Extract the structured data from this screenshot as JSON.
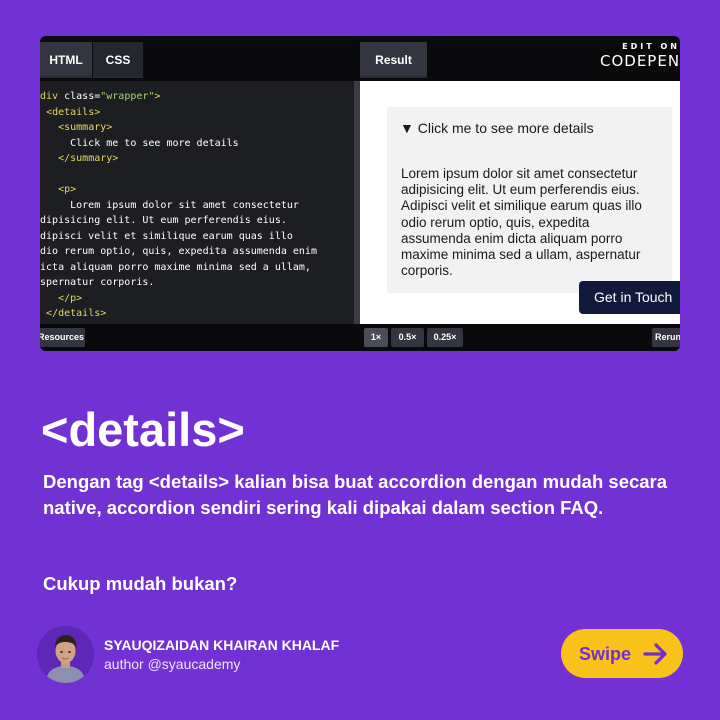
{
  "editor": {
    "tabs": {
      "html": "HTML",
      "css": "CSS",
      "result": "Result"
    },
    "logo": {
      "top": "EDIT ON",
      "name": "CODEPEN"
    },
    "code_lines": [
      [
        {
          "t": "tag",
          "v": "<div "
        },
        {
          "t": "attr",
          "v": "class="
        },
        {
          "t": "str",
          "v": "\"wrapper\""
        },
        {
          "t": "tag",
          "v": ">"
        }
      ],
      [
        {
          "t": "plain",
          "v": "  "
        },
        {
          "t": "tag",
          "v": "<details>"
        }
      ],
      [
        {
          "t": "plain",
          "v": "    "
        },
        {
          "t": "tag",
          "v": "<summary>"
        }
      ],
      [
        {
          "t": "plain",
          "v": "      Click me to see more details"
        }
      ],
      [
        {
          "t": "plain",
          "v": "    "
        },
        {
          "t": "tag",
          "v": "</summary>"
        }
      ],
      [
        {
          "t": "plain",
          "v": ""
        }
      ],
      [
        {
          "t": "plain",
          "v": "    "
        },
        {
          "t": "tag",
          "v": "<p>"
        }
      ],
      [
        {
          "t": "plain",
          "v": "      Lorem ipsum dolor sit amet consectetur"
        }
      ],
      [
        {
          "t": "plain",
          "v": "adipisicing elit. Ut eum perferendis eius."
        }
      ],
      [
        {
          "t": "plain",
          "v": "Adipisci velit et similique earum quas illo"
        }
      ],
      [
        {
          "t": "plain",
          "v": "odio rerum optio, quis, expedita assumenda enim"
        }
      ],
      [
        {
          "t": "plain",
          "v": "dicta aliquam porro maxime minima sed a ullam,"
        }
      ],
      [
        {
          "t": "plain",
          "v": "aspernatur corporis."
        }
      ],
      [
        {
          "t": "plain",
          "v": "    "
        },
        {
          "t": "tag",
          "v": "</p>"
        }
      ],
      [
        {
          "t": "plain",
          "v": "  "
        },
        {
          "t": "tag",
          "v": "</details>"
        }
      ]
    ],
    "result": {
      "summary": "▼ Click me to see more details",
      "paragraph": "Lorem ipsum dolor sit amet consectetur adipisicing elit. Ut eum perferendis eius. Adipisci velit et similique earum quas illo odio rerum optio, quis, expedita assumenda enim dicta aliquam porro maxime minima sed a ullam, aspernatur corporis.",
      "button": "Get in Touch"
    },
    "footer": {
      "resources": "Resources",
      "zoom_1": "1×",
      "zoom_2": "0.5×",
      "zoom_3": "0.25×",
      "rerun": "Rerun"
    }
  },
  "headline": "<details>",
  "description": "Dengan tag <details> kalian bisa buat accordion dengan mudah secara native, accordion sendiri sering kali dipakai dalam section FAQ.",
  "question": "Cukup mudah bukan?",
  "author": {
    "name": "SYAUQIZAIDAN KHAIRAN KHALAF",
    "handle": "author @syaucademy"
  },
  "swipe": {
    "label": "Swipe"
  },
  "colors": {
    "background": "#7232d3",
    "accent": "#f8c21b",
    "button_dark": "#111a3a"
  }
}
